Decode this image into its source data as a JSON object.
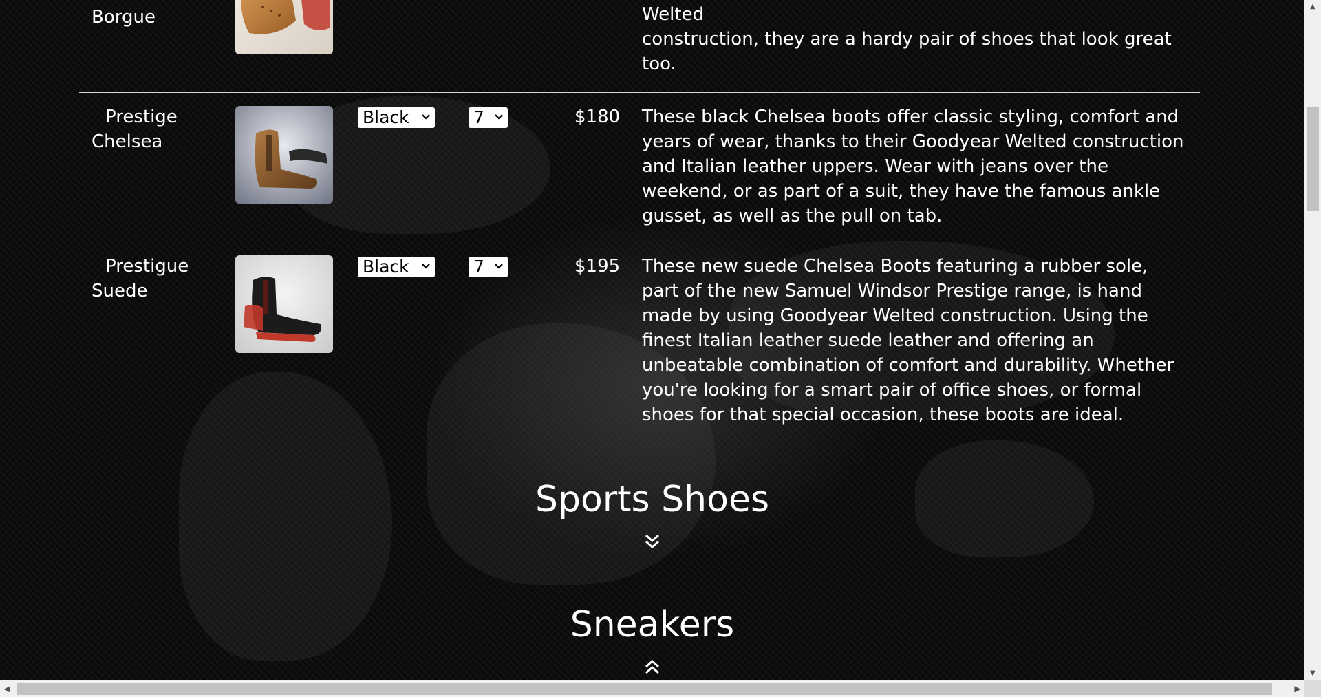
{
  "products": [
    {
      "name": "Borgue",
      "description_lines": [
        "makes them superbly comfortable. Made with Goodyear Welted",
        "construction, they are a hardy pair of shoes that look great",
        "too."
      ]
    },
    {
      "name": "Prestige Chelsea",
      "color": "Black",
      "size": "7",
      "price": "$180",
      "description": "These black Chelsea boots offer classic styling, comfort and years of wear, thanks to their Goodyear Welted construction and Italian leather uppers. Wear with jeans over the weekend, or as part of a suit, they have the famous ankle gusset, as well as the pull on tab."
    },
    {
      "name": "Prestigue Suede",
      "color": "Black",
      "size": "7",
      "price": "$195",
      "description": "These new suede Chelsea Boots featuring a rubber sole, part of the new Samuel Windsor Prestige range, is hand made by using Goodyear Welted construction. Using the finest Italian leather suede leather and offering an unbeatable combination of comfort and durability. Whether you're looking for a smart pair of office shoes, or formal shoes for that special occasion, these boots are ideal."
    }
  ],
  "sections": {
    "sports_heading": "Sports Shoes",
    "sneakers_heading": "Sneakers"
  },
  "icons": {
    "expand": "double-chevron-down-icon",
    "collapse": "double-chevron-up-icon",
    "select_caret": "chevron-down-icon"
  },
  "colors": {
    "page_background": "#0a0a0a",
    "text": "#ffffff",
    "divider": "#d8d8d8",
    "select_background": "#ffffff"
  }
}
